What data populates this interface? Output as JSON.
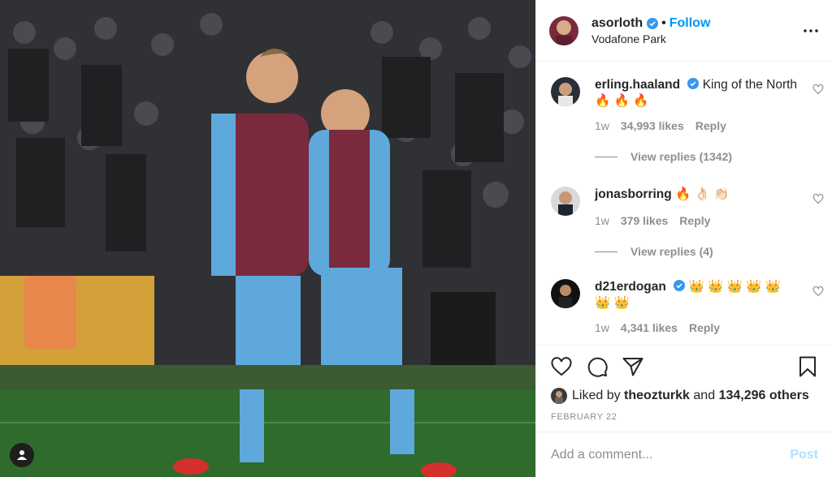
{
  "post": {
    "image_alt": "photo",
    "user_tag_icon": "user-icon"
  },
  "header": {
    "username": "asorloth",
    "dot": "•",
    "follow_label": "Follow",
    "location": "Vodafone Park",
    "more_icon": "ellipsis-icon"
  },
  "comments": [
    {
      "username": "erling.haaland",
      "verified": true,
      "text": "King of the North🔥 🔥 🔥",
      "age": "1w",
      "likes": "34,993 likes",
      "reply_label": "Reply",
      "view_replies": "View replies (1342)"
    },
    {
      "username": "jonasborring",
      "verified": false,
      "text": "🔥 👌🏻 👏🏻",
      "age": "1w",
      "likes": "379 likes",
      "reply_label": "Reply",
      "view_replies": "View replies (4)"
    },
    {
      "username": "d21erdogan",
      "verified": true,
      "text": "👑 👑 👑 👑 👑 👑 👑",
      "age": "1w",
      "likes": "4,341 likes",
      "reply_label": "Reply"
    }
  ],
  "actions": {
    "like_icon": "heart-icon",
    "comment_icon": "comment-icon",
    "share_icon": "share-icon",
    "save_icon": "bookmark-icon"
  },
  "likes": {
    "prefix": "Liked by",
    "user": "theozturkk",
    "middle": "and",
    "others": "134,296 others"
  },
  "date": "FEBRUARY 22",
  "add_comment": {
    "placeholder": "Add a comment...",
    "post_label": "Post"
  },
  "colors": {
    "accent": "#0095f6",
    "post_disabled": "#b2dffc",
    "muted": "#8e8e8e"
  }
}
